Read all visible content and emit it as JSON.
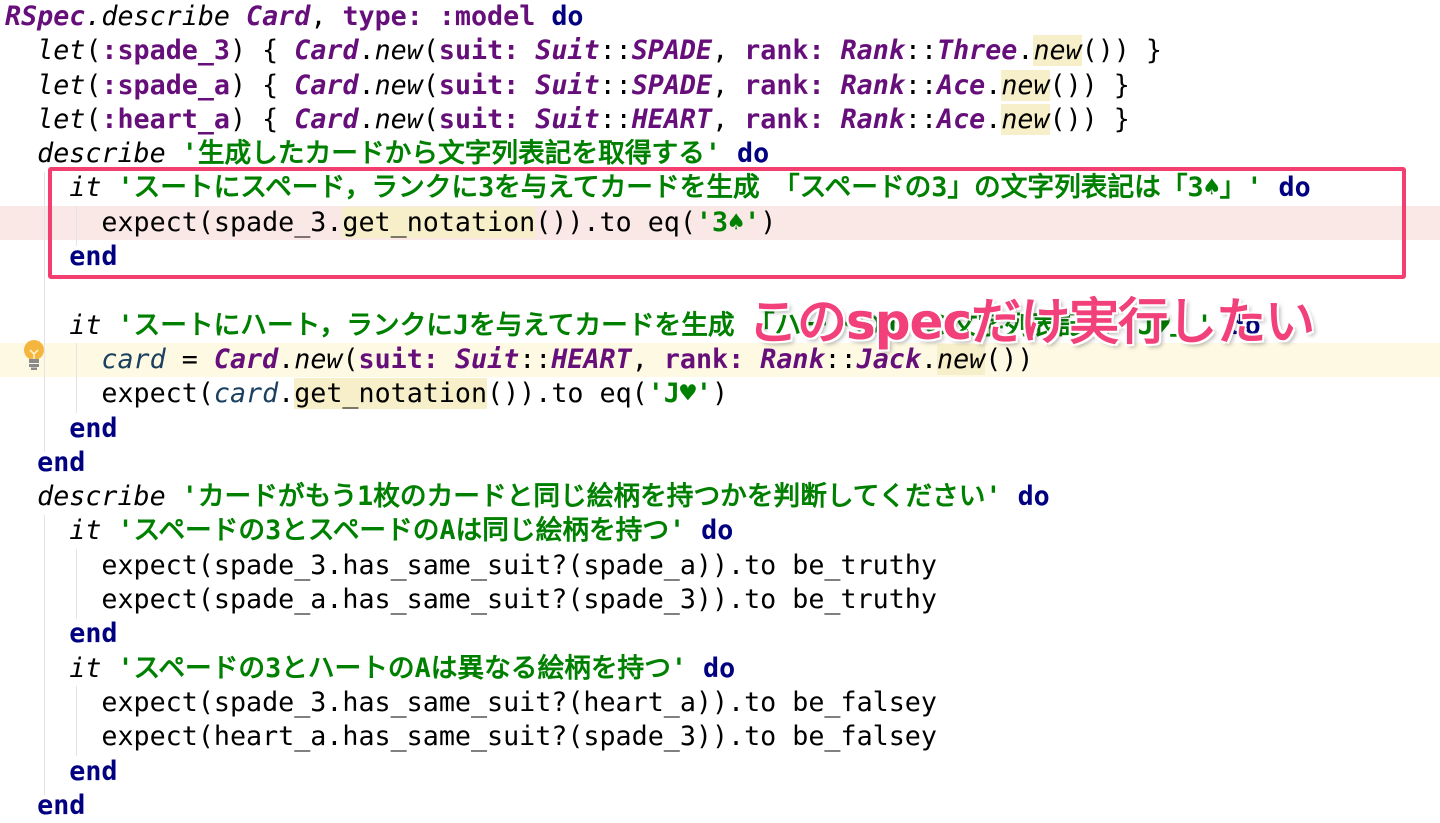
{
  "code": {
    "lines": [
      {
        "tokens": [
          {
            "c": "const",
            "t": "RSpec"
          },
          {
            "c": "mi",
            "t": ".describe "
          },
          {
            "c": "const",
            "t": "Card"
          },
          {
            "c": "",
            "t": ", "
          },
          {
            "c": "sym",
            "t": "type: :model "
          },
          {
            "c": "kw",
            "t": "do"
          }
        ]
      },
      {
        "tokens": [
          {
            "c": "",
            "t": "  "
          },
          {
            "c": "mi",
            "t": "let"
          },
          {
            "c": "",
            "t": "("
          },
          {
            "c": "sym",
            "t": ":spade_3"
          },
          {
            "c": "",
            "t": ") { "
          },
          {
            "c": "const",
            "t": "Card"
          },
          {
            "c": "",
            "t": "."
          },
          {
            "c": "mi",
            "t": "new"
          },
          {
            "c": "",
            "t": "("
          },
          {
            "c": "sym",
            "t": "suit: "
          },
          {
            "c": "const",
            "t": "Suit"
          },
          {
            "c": "",
            "t": "::"
          },
          {
            "c": "const",
            "t": "SPADE"
          },
          {
            "c": "",
            "t": ", "
          },
          {
            "c": "sym",
            "t": "rank: "
          },
          {
            "c": "const",
            "t": "Rank"
          },
          {
            "c": "",
            "t": "::"
          },
          {
            "c": "const",
            "t": "Three"
          },
          {
            "c": "",
            "t": "."
          },
          {
            "c": "mi hl",
            "t": "new"
          },
          {
            "c": "",
            "t": "()) }"
          }
        ]
      },
      {
        "tokens": [
          {
            "c": "",
            "t": "  "
          },
          {
            "c": "mi",
            "t": "let"
          },
          {
            "c": "",
            "t": "("
          },
          {
            "c": "sym",
            "t": ":spade_a"
          },
          {
            "c": "",
            "t": ") { "
          },
          {
            "c": "const",
            "t": "Card"
          },
          {
            "c": "",
            "t": "."
          },
          {
            "c": "mi",
            "t": "new"
          },
          {
            "c": "",
            "t": "("
          },
          {
            "c": "sym",
            "t": "suit: "
          },
          {
            "c": "const",
            "t": "Suit"
          },
          {
            "c": "",
            "t": "::"
          },
          {
            "c": "const",
            "t": "SPADE"
          },
          {
            "c": "",
            "t": ", "
          },
          {
            "c": "sym",
            "t": "rank: "
          },
          {
            "c": "const",
            "t": "Rank"
          },
          {
            "c": "",
            "t": "::"
          },
          {
            "c": "const",
            "t": "Ace"
          },
          {
            "c": "",
            "t": "."
          },
          {
            "c": "mi hl",
            "t": "new"
          },
          {
            "c": "",
            "t": "()) }"
          }
        ]
      },
      {
        "tokens": [
          {
            "c": "",
            "t": "  "
          },
          {
            "c": "mi",
            "t": "let"
          },
          {
            "c": "",
            "t": "("
          },
          {
            "c": "sym",
            "t": ":heart_a"
          },
          {
            "c": "",
            "t": ") { "
          },
          {
            "c": "const",
            "t": "Card"
          },
          {
            "c": "",
            "t": "."
          },
          {
            "c": "mi",
            "t": "new"
          },
          {
            "c": "",
            "t": "("
          },
          {
            "c": "sym",
            "t": "suit: "
          },
          {
            "c": "const",
            "t": "Suit"
          },
          {
            "c": "",
            "t": "::"
          },
          {
            "c": "const",
            "t": "HEART"
          },
          {
            "c": "",
            "t": ", "
          },
          {
            "c": "sym",
            "t": "rank: "
          },
          {
            "c": "const",
            "t": "Rank"
          },
          {
            "c": "",
            "t": "::"
          },
          {
            "c": "const",
            "t": "Ace"
          },
          {
            "c": "",
            "t": "."
          },
          {
            "c": "mi hl",
            "t": "new"
          },
          {
            "c": "",
            "t": "()) }"
          }
        ]
      },
      {
        "tokens": [
          {
            "c": "",
            "t": "  "
          },
          {
            "c": "mi",
            "t": "describe "
          },
          {
            "c": "str",
            "t": "'生成したカードから文字列表記を取得する' "
          },
          {
            "c": "kw",
            "t": "do"
          }
        ]
      },
      {
        "tokens": [
          {
            "c": "",
            "t": "    "
          },
          {
            "c": "mi",
            "t": "it "
          },
          {
            "c": "str",
            "t": "'スートにスペード，ランクに3を与えてカードを生成　「スペードの3」の文字列表記は「3♠」' "
          },
          {
            "c": "kw",
            "t": "do"
          }
        ]
      },
      {
        "state": "err",
        "tokens": [
          {
            "c": "",
            "t": "      expect(spade_3."
          },
          {
            "c": "hl",
            "t": "get_notation"
          },
          {
            "c": "",
            "t": "()).to eq("
          },
          {
            "c": "str",
            "t": "'3♠'"
          },
          {
            "c": "",
            "t": ")"
          }
        ]
      },
      {
        "tokens": [
          {
            "c": "",
            "t": "    "
          },
          {
            "c": "kw",
            "t": "end"
          }
        ]
      },
      {
        "tokens": []
      },
      {
        "tokens": [
          {
            "c": "",
            "t": "    "
          },
          {
            "c": "mi",
            "t": "it "
          },
          {
            "c": "str",
            "t": "'スートにハート，ランクにJを与えてカードを生成　「ハートのJ」の文字列表記は「J♥」' "
          },
          {
            "c": "kw",
            "t": "do"
          }
        ]
      },
      {
        "state": "cur",
        "tokens": [
          {
            "c": "",
            "t": "      "
          },
          {
            "c": "var",
            "t": "card"
          },
          {
            "c": "",
            "t": " = "
          },
          {
            "c": "const",
            "t": "Card"
          },
          {
            "c": "",
            "t": "."
          },
          {
            "c": "mi",
            "t": "new"
          },
          {
            "c": "",
            "t": "("
          },
          {
            "c": "sym",
            "t": "suit: "
          },
          {
            "c": "const",
            "t": "Suit"
          },
          {
            "c": "",
            "t": "::"
          },
          {
            "c": "const",
            "t": "HEART"
          },
          {
            "c": "",
            "t": ", "
          },
          {
            "c": "sym",
            "t": "rank: "
          },
          {
            "c": "const",
            "t": "Rank"
          },
          {
            "c": "",
            "t": "::"
          },
          {
            "c": "const",
            "t": "Jack"
          },
          {
            "c": "",
            "t": "."
          },
          {
            "c": "mi hl",
            "t": "new"
          },
          {
            "c": "",
            "t": "())"
          }
        ]
      },
      {
        "tokens": [
          {
            "c": "",
            "t": "      expect("
          },
          {
            "c": "var",
            "t": "card"
          },
          {
            "c": "",
            "t": "."
          },
          {
            "c": "hl",
            "t": "get_notation"
          },
          {
            "c": "",
            "t": "()).to eq("
          },
          {
            "c": "str",
            "t": "'J♥'"
          },
          {
            "c": "",
            "t": ")"
          }
        ]
      },
      {
        "tokens": [
          {
            "c": "",
            "t": "    "
          },
          {
            "c": "kw",
            "t": "end"
          }
        ]
      },
      {
        "tokens": [
          {
            "c": "",
            "t": "  "
          },
          {
            "c": "kw",
            "t": "end"
          }
        ]
      },
      {
        "tokens": [
          {
            "c": "",
            "t": "  "
          },
          {
            "c": "mi",
            "t": "describe "
          },
          {
            "c": "str",
            "t": "'カードがもう1枚のカードと同じ絵柄を持つかを判断してください' "
          },
          {
            "c": "kw",
            "t": "do"
          }
        ]
      },
      {
        "tokens": [
          {
            "c": "",
            "t": "    "
          },
          {
            "c": "mi",
            "t": "it "
          },
          {
            "c": "str",
            "t": "'スペードの3とスペードのAは同じ絵柄を持つ' "
          },
          {
            "c": "kw",
            "t": "do"
          }
        ]
      },
      {
        "tokens": [
          {
            "c": "",
            "t": "      expect(spade_3.has_same_suit?(spade_a)).to be_truthy"
          }
        ]
      },
      {
        "tokens": [
          {
            "c": "",
            "t": "      expect(spade_a.has_same_suit?(spade_3)).to be_truthy"
          }
        ]
      },
      {
        "tokens": [
          {
            "c": "",
            "t": "    "
          },
          {
            "c": "kw",
            "t": "end"
          }
        ]
      },
      {
        "tokens": [
          {
            "c": "",
            "t": "    "
          },
          {
            "c": "mi",
            "t": "it "
          },
          {
            "c": "str",
            "t": "'スペードの3とハートのAは異なる絵柄を持つ' "
          },
          {
            "c": "kw",
            "t": "do"
          }
        ]
      },
      {
        "tokens": [
          {
            "c": "",
            "t": "      expect(spade_3.has_same_suit?(heart_a)).to be_falsey"
          }
        ]
      },
      {
        "tokens": [
          {
            "c": "",
            "t": "      expect(heart_a.has_same_suit?(spade_3)).to be_falsey"
          }
        ]
      },
      {
        "tokens": [
          {
            "c": "",
            "t": "    "
          },
          {
            "c": "kw",
            "t": "end"
          }
        ]
      },
      {
        "tokens": [
          {
            "c": "",
            "t": "  "
          },
          {
            "c": "kw",
            "t": "end"
          }
        ]
      }
    ]
  },
  "annotation": {
    "text": "このspecだけ実行したい",
    "color": "#f2407a"
  },
  "gutter": {
    "intention_icon": "lightbulb-icon"
  }
}
